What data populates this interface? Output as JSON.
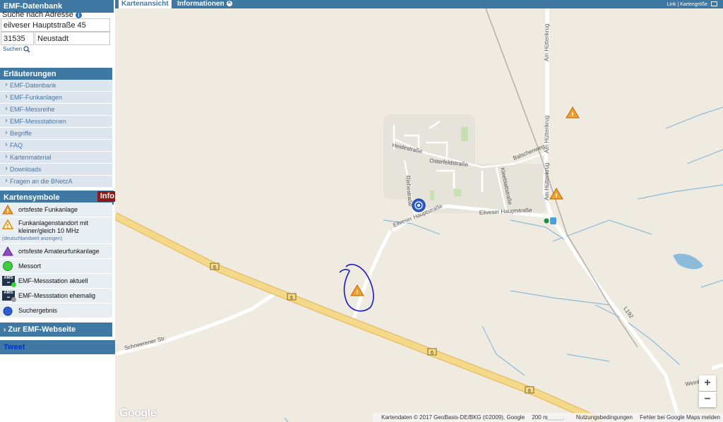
{
  "sidebar": {
    "emf_header": "EMF-Datenbank",
    "search_label": "Suche nach Adresse",
    "street_value": "eilveser Hauptstraße 45",
    "zip_value": "31535",
    "city_value": "Neustadt",
    "search_button": "Suchen",
    "explanations_header": "Erläuterungen",
    "nav_items": [
      "EMF-Datenbank",
      "EMF-Funkanlagen",
      "EMF-Messreihe",
      "EMF-Messstationen",
      "Begriffe",
      "FAQ",
      "Kartenmaterial",
      "Downloads",
      "Fragen an die BNetzA"
    ],
    "symbols_header": "Kartensymbole",
    "info_badge": "Info",
    "legend": [
      {
        "label": "ortsfeste Funkanlage",
        "icon": "orange-warning-triangle-icon"
      },
      {
        "label": "Funkanlagenstandort mit kleiner/gleich 10 MHz",
        "sub": "(deutschlandweit anzeigen)",
        "icon": "orange-triangle-outline-icon"
      },
      {
        "label": "ortsfeste Amateurfunkanlage",
        "icon": "purple-triangle-icon"
      },
      {
        "label": "Messort",
        "icon": "green-dot-icon"
      },
      {
        "label": "EMF-Messstation aktuell",
        "icon": "ams-active-icon"
      },
      {
        "label": "EMF-Messstation ehemalig",
        "icon": "ams-former-icon"
      },
      {
        "label": "Suchergebnis",
        "icon": "blue-dot-icon"
      }
    ],
    "website_link": "Zur EMF-Webseite",
    "tweet": "Tweet"
  },
  "tabs": {
    "map_tab": "Kartenansicht",
    "info_tab": "Informationen",
    "top_right": "Link | Kartengröße"
  },
  "map": {
    "streets": {
      "am_huettenkrug": "Am Hüttenkrug",
      "heidestrasse": "Heidestraße",
      "osterfeldstrasse": "Osterfeldstraße",
      "balschenweg": "Balschenweg",
      "kleeblattstrasse": "Kleeblattstraße",
      "riehestrasse": "Riehestraße",
      "eilveser_hauptstrasse": "Eilveser Hauptstraße",
      "schneerener_str": "Schneerener Str.",
      "l192": "L192",
      "road_6": "6",
      "weint": "Weint"
    },
    "zoom_in": "+",
    "zoom_out": "−",
    "google": "Google",
    "attribution": {
      "data": "Kartendaten © 2017 GeoBasis-DE/BKG (©2009), Google",
      "scale": "200 m",
      "terms": "Nutzungsbedingungen",
      "report": "Fehler bei Google Maps melden"
    }
  },
  "colors": {
    "header_blue": "#3f78a3",
    "nav_bg": "#dde6ef",
    "map_bg": "#efebe1",
    "highway": "#f5d98a",
    "water": "#8bbbd8",
    "info_red": "#8b1a1a"
  }
}
